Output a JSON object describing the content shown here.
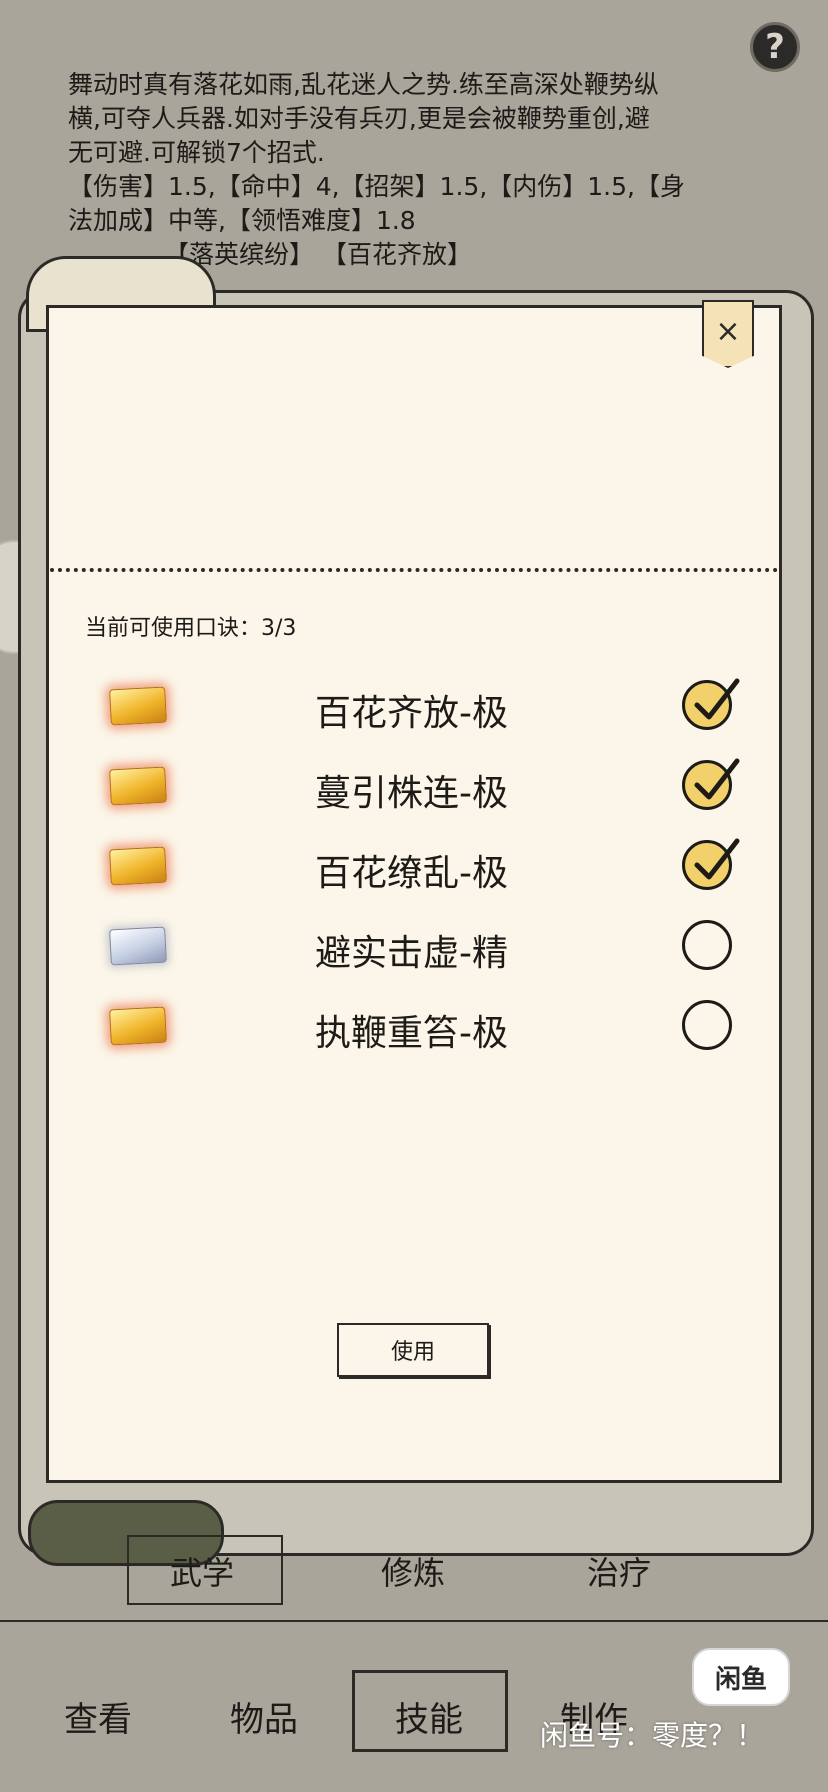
{
  "help_icon": "?",
  "description": {
    "line1": "舞动时真有落花如雨,乱花迷人之势.练至高深处鞭势纵",
    "line2": "横,可夺人兵器.如对手没有兵刃,更是会被鞭势重创,避",
    "line3": "无可避.可解锁7个招式.",
    "line4": "【伤害】1.5,【命中】4,【招架】1.5,【内伤】1.5,【身",
    "line5": "法加成】中等,【领悟难度】1.8",
    "line6": "【落英缤纷】 【百花齐放】"
  },
  "dialog": {
    "close_icon": "×",
    "count_label": "当前可使用口诀：3/3",
    "use_label": "使用",
    "skills": [
      {
        "name": "百花齐放-极",
        "tier": "gold",
        "checked": true
      },
      {
        "name": "蔓引株连-极",
        "tier": "gold",
        "checked": true
      },
      {
        "name": "百花缭乱-极",
        "tier": "gold",
        "checked": true
      },
      {
        "name": "避实击虚-精",
        "tier": "silver",
        "checked": false
      },
      {
        "name": "执鞭重笞-极",
        "tier": "gold",
        "checked": false
      }
    ]
  },
  "mid_tabs": {
    "wuxue": "武学",
    "xiulian": "修炼",
    "zhiliao": "治疗"
  },
  "bottom_nav": {
    "view": "查看",
    "items": "物品",
    "skills": "技能",
    "craft": "制作"
  },
  "watermark": {
    "logo": "闲鱼",
    "text": "闲鱼号：零度？！"
  },
  "colors": {
    "background": "#a9a59b",
    "panel": "#fbf6e9",
    "check_fill": "#f2d16a",
    "gold_chip": "#f0b52b",
    "silver_chip": "#c6d0e4"
  }
}
